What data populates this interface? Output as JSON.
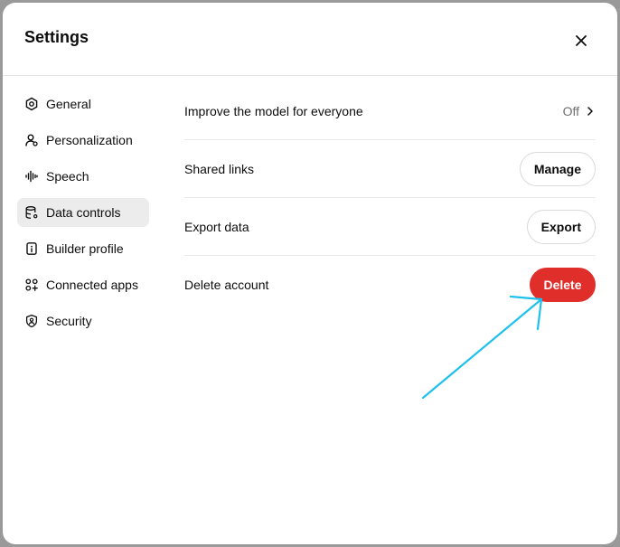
{
  "dialog": {
    "title": "Settings",
    "close_icon": "close-icon"
  },
  "sidebar": {
    "items": [
      {
        "label": "General",
        "icon": "gear-icon",
        "active": false
      },
      {
        "label": "Personalization",
        "icon": "person-icon",
        "active": false
      },
      {
        "label": "Speech",
        "icon": "waveform-icon",
        "active": false
      },
      {
        "label": "Data controls",
        "icon": "database-icon",
        "active": true
      },
      {
        "label": "Builder profile",
        "icon": "id-badge-icon",
        "active": false
      },
      {
        "label": "Connected apps",
        "icon": "apps-icon",
        "active": false
      },
      {
        "label": "Security",
        "icon": "shield-icon",
        "active": false
      }
    ]
  },
  "data_controls": {
    "improve_model": {
      "label": "Improve the model for everyone",
      "value": "Off"
    },
    "shared_links": {
      "label": "Shared links",
      "button": "Manage"
    },
    "export_data": {
      "label": "Export data",
      "button": "Export"
    },
    "delete_account": {
      "label": "Delete account",
      "button": "Delete"
    }
  },
  "colors": {
    "danger": "#e02e2a",
    "annotation_arrow": "#1ec0ec",
    "active_nav_bg": "#ececec"
  }
}
